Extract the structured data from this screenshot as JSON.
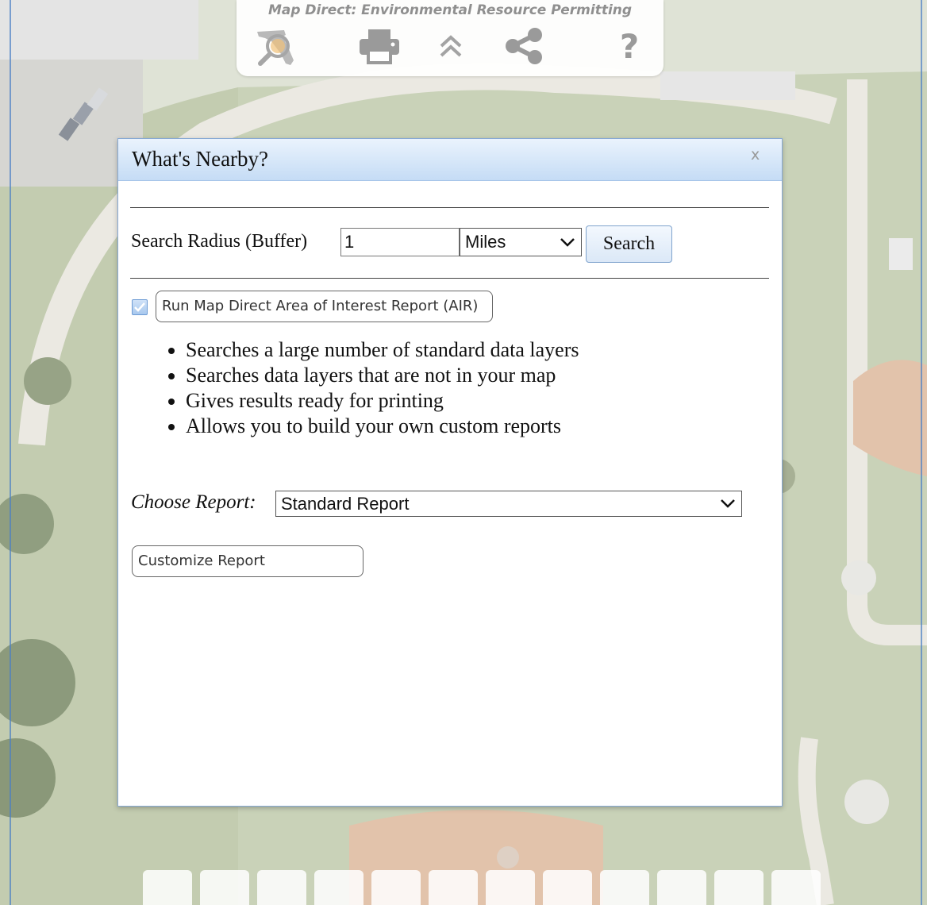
{
  "toolbar": {
    "title": "Map Direct: Environmental Resource Permitting",
    "icons": [
      "florida-search-icon",
      "print-icon",
      "collapse-up-icon",
      "share-icon",
      "help-icon"
    ],
    "help_glyph": "?"
  },
  "dialog": {
    "title": "What's Nearby?",
    "close_glyph": "x",
    "search_radius_label": "Search Radius (Buffer)",
    "radius_value": "1",
    "unit_selected": "Miles",
    "search_button": "Search",
    "air_checkbox_checked": true,
    "air_button_label": "Run Map Direct Area of Interest Report (AIR)",
    "bullets": [
      "Searches a large number of standard data layers",
      "Searches data layers that are not in your map",
      "Gives results ready for printing",
      "Allows you to build your own custom reports"
    ],
    "choose_report_label": "Choose Report:",
    "report_selected": "Standard Report",
    "customize_button": "Customize Report"
  },
  "colors": {
    "dialog_header_top": "#eaf3fd",
    "dialog_header_bottom": "#c5dcf5",
    "button_border": "#7fa3cd",
    "map_grass": "#c6cfb3",
    "map_infield": "#e3c2aa"
  }
}
